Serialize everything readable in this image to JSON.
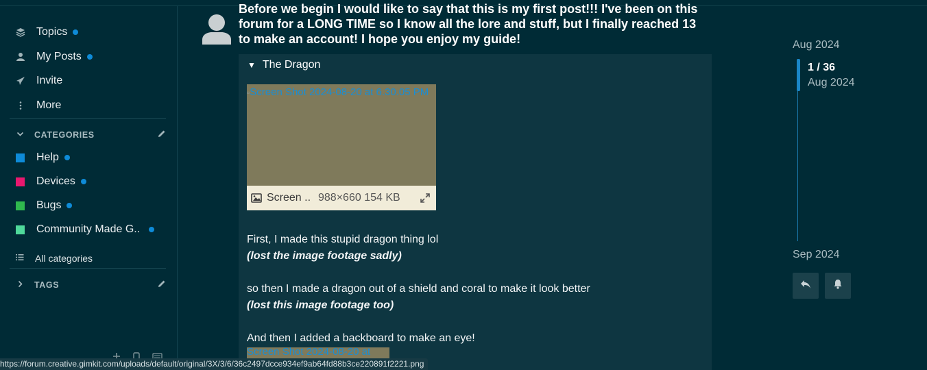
{
  "sidebar": {
    "nav": [
      {
        "label": "Topics",
        "icon": "layers-icon",
        "unread": true
      },
      {
        "label": "My Posts",
        "icon": "user-icon",
        "unread": true
      },
      {
        "label": "Invite",
        "icon": "paper-plane-icon",
        "unread": false
      },
      {
        "label": "More",
        "icon": "vertical-ellipsis-icon",
        "unread": false
      }
    ],
    "categories_header": "CATEGORIES",
    "categories": [
      {
        "label": "Help",
        "color": "#0e8bd8"
      },
      {
        "label": "Devices",
        "color": "#e9186f"
      },
      {
        "label": "Bugs",
        "color": "#2fb84e"
      },
      {
        "label": "Community Made G...",
        "color": "#4fd99b"
      }
    ],
    "all_categories": "All categories",
    "tags_header": "TAGS"
  },
  "post": {
    "title": "Before we begin I would like to say that this is my first post!!! I've been on this forum for a LONG TIME so I know all the lore and stuff, but I finally reached 13 to make an account! I hope you enjoy my guide!",
    "details_summary": "The Dragon",
    "image1": {
      "alt": "Screen Shot 2024-08-20 at 6.30.05 PM",
      "filename": "Screen Shot 2024-08-20 at 6.30.05 PM",
      "filename_display": "Screen ...",
      "info": "988×660 154 KB"
    },
    "para1": "First, I made this stupid dragon thing lol",
    "para1_em": "(lost the image footage sadly)",
    "para2": "so then I made a dragon out of a shield and coral to make it look better",
    "para2_em": "(lost this image footage too)",
    "para3": "And then I added a backboard to make an eye!",
    "image2_alt": "Screen Shot 2024-08-20 at"
  },
  "timeline": {
    "start_date": "Aug 2024",
    "position": "1 / 36",
    "position_date": "Aug 2024",
    "end_date": "Sep 2024"
  },
  "statusbar": {
    "url": "https://forum.creative.gimkit.com/uploads/default/original/3X/3/6/36c2497dcce934ef9ab64fd88b3ce220891f2221.png"
  },
  "colors": {
    "background": "#002b36",
    "accent": "#0e8bd8",
    "post_block": "#0e3641"
  }
}
